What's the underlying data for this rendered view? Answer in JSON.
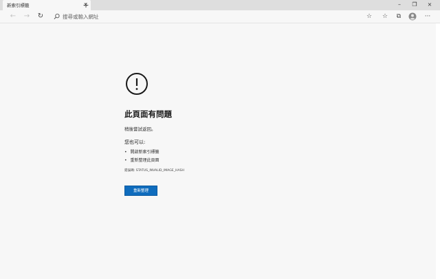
{
  "tab": {
    "title": "新索引標籤",
    "close_glyph": "×",
    "new_tab_glyph": "+"
  },
  "window_controls": {
    "minimize": "–",
    "restore": "❐",
    "close": "×"
  },
  "toolbar": {
    "back_glyph": "←",
    "forward_glyph": "→",
    "refresh_glyph": "↻",
    "address_placeholder": "搜尋或輸入網址",
    "favorite_glyph": "☆",
    "favorites_bar_glyph": "☆",
    "collections_glyph": "⧉",
    "more_glyph": "···"
  },
  "error_page": {
    "heading": "此頁面有問題",
    "subtext": "稍後嘗試返回。",
    "try_title": "您也可以:",
    "suggestions": [
      "開啟新索引標籤",
      "重新整理此頁面"
    ],
    "error_code": "錯誤碼: STATUS_INVALID_IMAGE_HASH",
    "reload_label": "重新整理"
  },
  "colors": {
    "accent": "#0f6cbd",
    "tabstrip": "#dedede",
    "page_bg": "#f7f7f7"
  }
}
